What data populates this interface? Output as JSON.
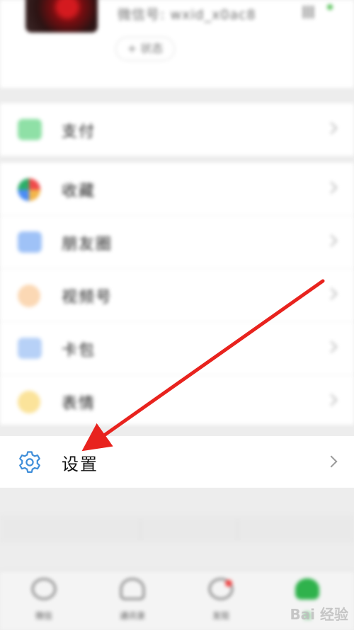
{
  "profile": {
    "wechat_id": "微信号: wxid_x0ac8",
    "status_button": "+ 状态"
  },
  "menu": {
    "group1": [
      {
        "label": "支付",
        "icon": "pay-icon",
        "color": "#2aae67"
      }
    ],
    "group2": [
      {
        "label": "收藏",
        "icon": "favorites-icon",
        "color": "#f3b64a"
      },
      {
        "label": "朋友圈",
        "icon": "moments-icon",
        "color": "#4c8df6"
      },
      {
        "label": "视频号",
        "icon": "channels-icon",
        "color": "#f0a24a"
      },
      {
        "label": "卡包",
        "icon": "card-package-icon",
        "color": "#4c8df6"
      },
      {
        "label": "表情",
        "icon": "stickers-icon",
        "color": "#f7c542"
      }
    ],
    "settings": {
      "label": "设置",
      "icon": "gear-icon",
      "color": "#3f8ed9"
    }
  },
  "tabbar": {
    "items": [
      {
        "label": "微信",
        "icon": "chat-icon"
      },
      {
        "label": "通讯录",
        "icon": "contacts-icon"
      },
      {
        "label": "发现",
        "icon": "discover-icon"
      },
      {
        "label": "我",
        "icon": "me-icon"
      }
    ]
  },
  "watermark": "Bai 经验",
  "annotation": {
    "arrow_color": "#e8231e"
  }
}
